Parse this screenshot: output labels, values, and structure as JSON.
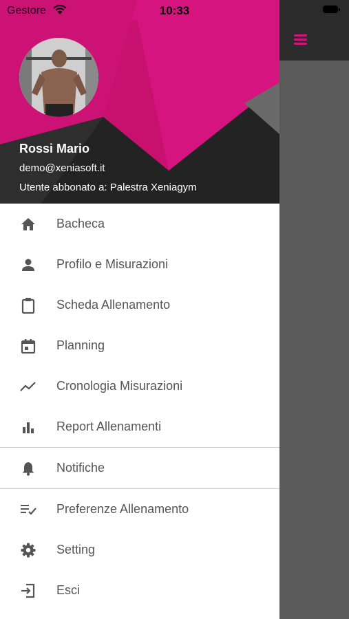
{
  "status_bar": {
    "carrier": "Gestore",
    "time": "10:33"
  },
  "colors": {
    "accent": "#d6147f",
    "header_dark": "#232323",
    "menu_text": "#555555",
    "icon": "#555555"
  },
  "user": {
    "name": "Rossi Mario",
    "email": "demo@xeniasoft.it",
    "subscription": "Utente abbonato a: Palestra Xeniagym"
  },
  "menu": {
    "group1": [
      {
        "label": "Bacheca",
        "icon": "home-icon"
      },
      {
        "label": "Profilo e Misurazioni",
        "icon": "person-icon"
      },
      {
        "label": "Scheda Allenamento",
        "icon": "clipboard-icon"
      },
      {
        "label": "Planning",
        "icon": "calendar-icon"
      },
      {
        "label": "Cronologia Misurazioni",
        "icon": "trending-icon"
      },
      {
        "label": "Report Allenamenti",
        "icon": "bar-chart-icon"
      }
    ],
    "group2": [
      {
        "label": "Notifiche",
        "icon": "bell-icon"
      }
    ],
    "group3": [
      {
        "label": "Preferenze Allenamento",
        "icon": "playlist-check-icon"
      },
      {
        "label": "Setting",
        "icon": "gear-icon"
      },
      {
        "label": "Esci",
        "icon": "exit-icon"
      }
    ]
  }
}
